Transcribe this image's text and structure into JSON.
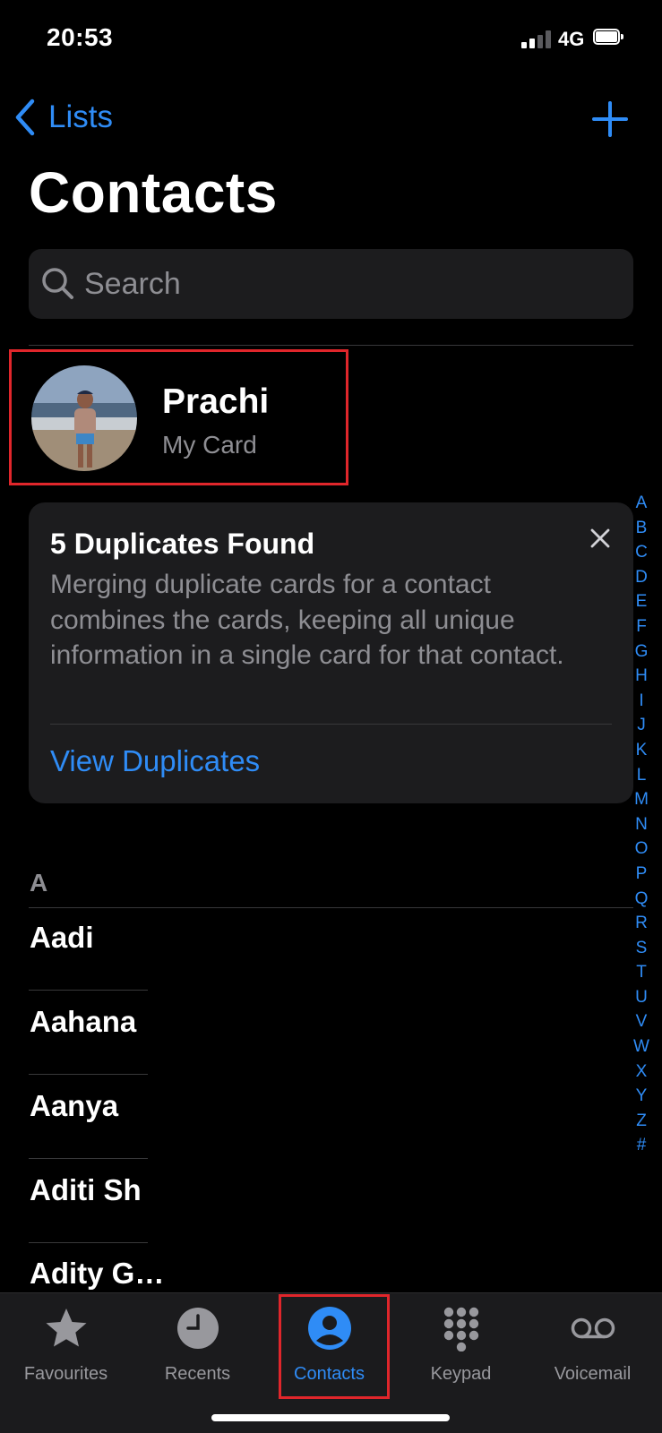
{
  "status_bar": {
    "time": "20:53",
    "network": "4G"
  },
  "nav": {
    "back_label": "Lists",
    "title": "Contacts"
  },
  "search": {
    "placeholder": "Search"
  },
  "my_card": {
    "name": "Prachi",
    "subtitle": "My Card"
  },
  "duplicates": {
    "title": "5 Duplicates Found",
    "description": "Merging duplicate cards for a contact combines the cards, keeping all unique information in a single card for that contact.",
    "link": "View Duplicates"
  },
  "index_letters": [
    "A",
    "B",
    "C",
    "D",
    "E",
    "F",
    "G",
    "H",
    "I",
    "J",
    "K",
    "L",
    "M",
    "N",
    "O",
    "P",
    "Q",
    "R",
    "S",
    "T",
    "U",
    "V",
    "W",
    "X",
    "Y",
    "Z",
    "#"
  ],
  "section_header": "A",
  "contacts": [
    "Aadi",
    "Aahana",
    "Aanya",
    "Aditi Sh",
    "Adity G…"
  ],
  "tabs": [
    {
      "label": "Favourites",
      "icon": "star-icon"
    },
    {
      "label": "Recents",
      "icon": "clock-icon"
    },
    {
      "label": "Contacts",
      "icon": "person-circle-icon"
    },
    {
      "label": "Keypad",
      "icon": "keypad-icon"
    },
    {
      "label": "Voicemail",
      "icon": "voicemail-icon"
    }
  ],
  "active_tab": "Contacts",
  "colors": {
    "accent": "#2f8cf6",
    "highlight": "#e0262b",
    "background": "#000000",
    "card": "#1c1c1e",
    "secondary_text": "#8e8e93"
  }
}
